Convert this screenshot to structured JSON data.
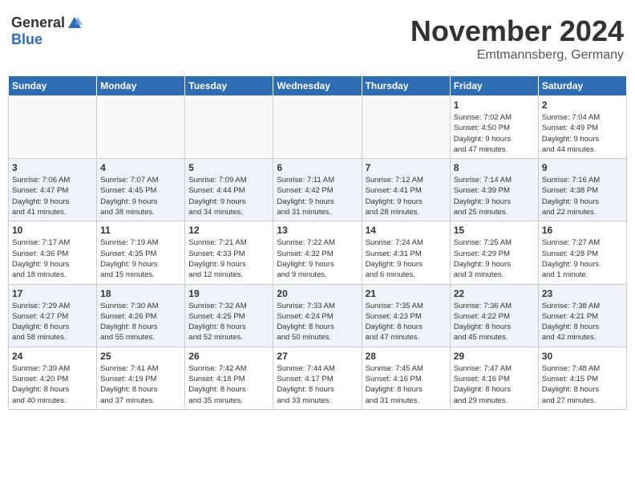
{
  "header": {
    "logo_general": "General",
    "logo_blue": "Blue",
    "month": "November 2024",
    "location": "Emtmannsberg, Germany"
  },
  "weekdays": [
    "Sunday",
    "Monday",
    "Tuesday",
    "Wednesday",
    "Thursday",
    "Friday",
    "Saturday"
  ],
  "weeks": [
    [
      {
        "day": "",
        "info": ""
      },
      {
        "day": "",
        "info": ""
      },
      {
        "day": "",
        "info": ""
      },
      {
        "day": "",
        "info": ""
      },
      {
        "day": "",
        "info": ""
      },
      {
        "day": "1",
        "info": "Sunrise: 7:02 AM\nSunset: 4:50 PM\nDaylight: 9 hours\nand 47 minutes."
      },
      {
        "day": "2",
        "info": "Sunrise: 7:04 AM\nSunset: 4:49 PM\nDaylight: 9 hours\nand 44 minutes."
      }
    ],
    [
      {
        "day": "3",
        "info": "Sunrise: 7:06 AM\nSunset: 4:47 PM\nDaylight: 9 hours\nand 41 minutes."
      },
      {
        "day": "4",
        "info": "Sunrise: 7:07 AM\nSunset: 4:45 PM\nDaylight: 9 hours\nand 38 minutes."
      },
      {
        "day": "5",
        "info": "Sunrise: 7:09 AM\nSunset: 4:44 PM\nDaylight: 9 hours\nand 34 minutes."
      },
      {
        "day": "6",
        "info": "Sunrise: 7:11 AM\nSunset: 4:42 PM\nDaylight: 9 hours\nand 31 minutes."
      },
      {
        "day": "7",
        "info": "Sunrise: 7:12 AM\nSunset: 4:41 PM\nDaylight: 9 hours\nand 28 minutes."
      },
      {
        "day": "8",
        "info": "Sunrise: 7:14 AM\nSunset: 4:39 PM\nDaylight: 9 hours\nand 25 minutes."
      },
      {
        "day": "9",
        "info": "Sunrise: 7:16 AM\nSunset: 4:38 PM\nDaylight: 9 hours\nand 22 minutes."
      }
    ],
    [
      {
        "day": "10",
        "info": "Sunrise: 7:17 AM\nSunset: 4:36 PM\nDaylight: 9 hours\nand 18 minutes."
      },
      {
        "day": "11",
        "info": "Sunrise: 7:19 AM\nSunset: 4:35 PM\nDaylight: 9 hours\nand 15 minutes."
      },
      {
        "day": "12",
        "info": "Sunrise: 7:21 AM\nSunset: 4:33 PM\nDaylight: 9 hours\nand 12 minutes."
      },
      {
        "day": "13",
        "info": "Sunrise: 7:22 AM\nSunset: 4:32 PM\nDaylight: 9 hours\nand 9 minutes."
      },
      {
        "day": "14",
        "info": "Sunrise: 7:24 AM\nSunset: 4:31 PM\nDaylight: 9 hours\nand 6 minutes."
      },
      {
        "day": "15",
        "info": "Sunrise: 7:25 AM\nSunset: 4:29 PM\nDaylight: 9 hours\nand 3 minutes."
      },
      {
        "day": "16",
        "info": "Sunrise: 7:27 AM\nSunset: 4:28 PM\nDaylight: 9 hours\nand 1 minute."
      }
    ],
    [
      {
        "day": "17",
        "info": "Sunrise: 7:29 AM\nSunset: 4:27 PM\nDaylight: 8 hours\nand 58 minutes."
      },
      {
        "day": "18",
        "info": "Sunrise: 7:30 AM\nSunset: 4:26 PM\nDaylight: 8 hours\nand 55 minutes."
      },
      {
        "day": "19",
        "info": "Sunrise: 7:32 AM\nSunset: 4:25 PM\nDaylight: 8 hours\nand 52 minutes."
      },
      {
        "day": "20",
        "info": "Sunrise: 7:33 AM\nSunset: 4:24 PM\nDaylight: 8 hours\nand 50 minutes."
      },
      {
        "day": "21",
        "info": "Sunrise: 7:35 AM\nSunset: 4:23 PM\nDaylight: 8 hours\nand 47 minutes."
      },
      {
        "day": "22",
        "info": "Sunrise: 7:36 AM\nSunset: 4:22 PM\nDaylight: 8 hours\nand 45 minutes."
      },
      {
        "day": "23",
        "info": "Sunrise: 7:38 AM\nSunset: 4:21 PM\nDaylight: 8 hours\nand 42 minutes."
      }
    ],
    [
      {
        "day": "24",
        "info": "Sunrise: 7:39 AM\nSunset: 4:20 PM\nDaylight: 8 hours\nand 40 minutes."
      },
      {
        "day": "25",
        "info": "Sunrise: 7:41 AM\nSunset: 4:19 PM\nDaylight: 8 hours\nand 37 minutes."
      },
      {
        "day": "26",
        "info": "Sunrise: 7:42 AM\nSunset: 4:18 PM\nDaylight: 8 hours\nand 35 minutes."
      },
      {
        "day": "27",
        "info": "Sunrise: 7:44 AM\nSunset: 4:17 PM\nDaylight: 8 hours\nand 33 minutes."
      },
      {
        "day": "28",
        "info": "Sunrise: 7:45 AM\nSunset: 4:16 PM\nDaylight: 8 hours\nand 31 minutes."
      },
      {
        "day": "29",
        "info": "Sunrise: 7:47 AM\nSunset: 4:16 PM\nDaylight: 8 hours\nand 29 minutes."
      },
      {
        "day": "30",
        "info": "Sunrise: 7:48 AM\nSunset: 4:15 PM\nDaylight: 8 hours\nand 27 minutes."
      }
    ]
  ]
}
